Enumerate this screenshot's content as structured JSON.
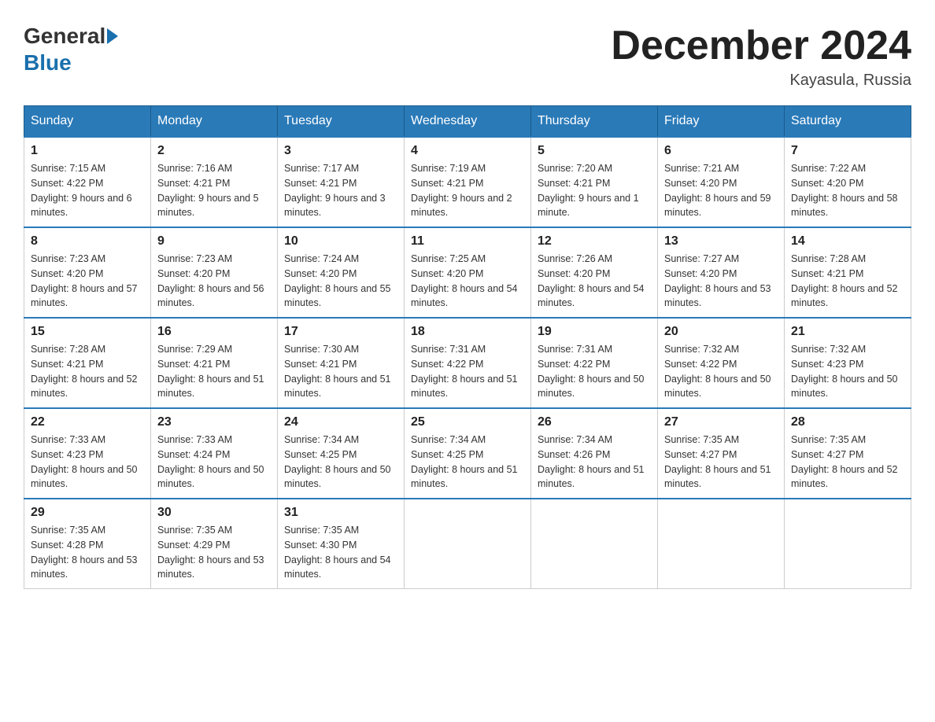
{
  "header": {
    "logo_general": "General",
    "logo_blue": "Blue",
    "month_title": "December 2024",
    "location": "Kayasula, Russia"
  },
  "calendar": {
    "days_of_week": [
      "Sunday",
      "Monday",
      "Tuesday",
      "Wednesday",
      "Thursday",
      "Friday",
      "Saturday"
    ],
    "weeks": [
      [
        {
          "day": "1",
          "sunrise": "7:15 AM",
          "sunset": "4:22 PM",
          "daylight": "9 hours and 6 minutes."
        },
        {
          "day": "2",
          "sunrise": "7:16 AM",
          "sunset": "4:21 PM",
          "daylight": "9 hours and 5 minutes."
        },
        {
          "day": "3",
          "sunrise": "7:17 AM",
          "sunset": "4:21 PM",
          "daylight": "9 hours and 3 minutes."
        },
        {
          "day": "4",
          "sunrise": "7:19 AM",
          "sunset": "4:21 PM",
          "daylight": "9 hours and 2 minutes."
        },
        {
          "day": "5",
          "sunrise": "7:20 AM",
          "sunset": "4:21 PM",
          "daylight": "9 hours and 1 minute."
        },
        {
          "day": "6",
          "sunrise": "7:21 AM",
          "sunset": "4:20 PM",
          "daylight": "8 hours and 59 minutes."
        },
        {
          "day": "7",
          "sunrise": "7:22 AM",
          "sunset": "4:20 PM",
          "daylight": "8 hours and 58 minutes."
        }
      ],
      [
        {
          "day": "8",
          "sunrise": "7:23 AM",
          "sunset": "4:20 PM",
          "daylight": "8 hours and 57 minutes."
        },
        {
          "day": "9",
          "sunrise": "7:23 AM",
          "sunset": "4:20 PM",
          "daylight": "8 hours and 56 minutes."
        },
        {
          "day": "10",
          "sunrise": "7:24 AM",
          "sunset": "4:20 PM",
          "daylight": "8 hours and 55 minutes."
        },
        {
          "day": "11",
          "sunrise": "7:25 AM",
          "sunset": "4:20 PM",
          "daylight": "8 hours and 54 minutes."
        },
        {
          "day": "12",
          "sunrise": "7:26 AM",
          "sunset": "4:20 PM",
          "daylight": "8 hours and 54 minutes."
        },
        {
          "day": "13",
          "sunrise": "7:27 AM",
          "sunset": "4:20 PM",
          "daylight": "8 hours and 53 minutes."
        },
        {
          "day": "14",
          "sunrise": "7:28 AM",
          "sunset": "4:21 PM",
          "daylight": "8 hours and 52 minutes."
        }
      ],
      [
        {
          "day": "15",
          "sunrise": "7:28 AM",
          "sunset": "4:21 PM",
          "daylight": "8 hours and 52 minutes."
        },
        {
          "day": "16",
          "sunrise": "7:29 AM",
          "sunset": "4:21 PM",
          "daylight": "8 hours and 51 minutes."
        },
        {
          "day": "17",
          "sunrise": "7:30 AM",
          "sunset": "4:21 PM",
          "daylight": "8 hours and 51 minutes."
        },
        {
          "day": "18",
          "sunrise": "7:31 AM",
          "sunset": "4:22 PM",
          "daylight": "8 hours and 51 minutes."
        },
        {
          "day": "19",
          "sunrise": "7:31 AM",
          "sunset": "4:22 PM",
          "daylight": "8 hours and 50 minutes."
        },
        {
          "day": "20",
          "sunrise": "7:32 AM",
          "sunset": "4:22 PM",
          "daylight": "8 hours and 50 minutes."
        },
        {
          "day": "21",
          "sunrise": "7:32 AM",
          "sunset": "4:23 PM",
          "daylight": "8 hours and 50 minutes."
        }
      ],
      [
        {
          "day": "22",
          "sunrise": "7:33 AM",
          "sunset": "4:23 PM",
          "daylight": "8 hours and 50 minutes."
        },
        {
          "day": "23",
          "sunrise": "7:33 AM",
          "sunset": "4:24 PM",
          "daylight": "8 hours and 50 minutes."
        },
        {
          "day": "24",
          "sunrise": "7:34 AM",
          "sunset": "4:25 PM",
          "daylight": "8 hours and 50 minutes."
        },
        {
          "day": "25",
          "sunrise": "7:34 AM",
          "sunset": "4:25 PM",
          "daylight": "8 hours and 51 minutes."
        },
        {
          "day": "26",
          "sunrise": "7:34 AM",
          "sunset": "4:26 PM",
          "daylight": "8 hours and 51 minutes."
        },
        {
          "day": "27",
          "sunrise": "7:35 AM",
          "sunset": "4:27 PM",
          "daylight": "8 hours and 51 minutes."
        },
        {
          "day": "28",
          "sunrise": "7:35 AM",
          "sunset": "4:27 PM",
          "daylight": "8 hours and 52 minutes."
        }
      ],
      [
        {
          "day": "29",
          "sunrise": "7:35 AM",
          "sunset": "4:28 PM",
          "daylight": "8 hours and 53 minutes."
        },
        {
          "day": "30",
          "sunrise": "7:35 AM",
          "sunset": "4:29 PM",
          "daylight": "8 hours and 53 minutes."
        },
        {
          "day": "31",
          "sunrise": "7:35 AM",
          "sunset": "4:30 PM",
          "daylight": "8 hours and 54 minutes."
        },
        null,
        null,
        null,
        null
      ]
    ]
  }
}
